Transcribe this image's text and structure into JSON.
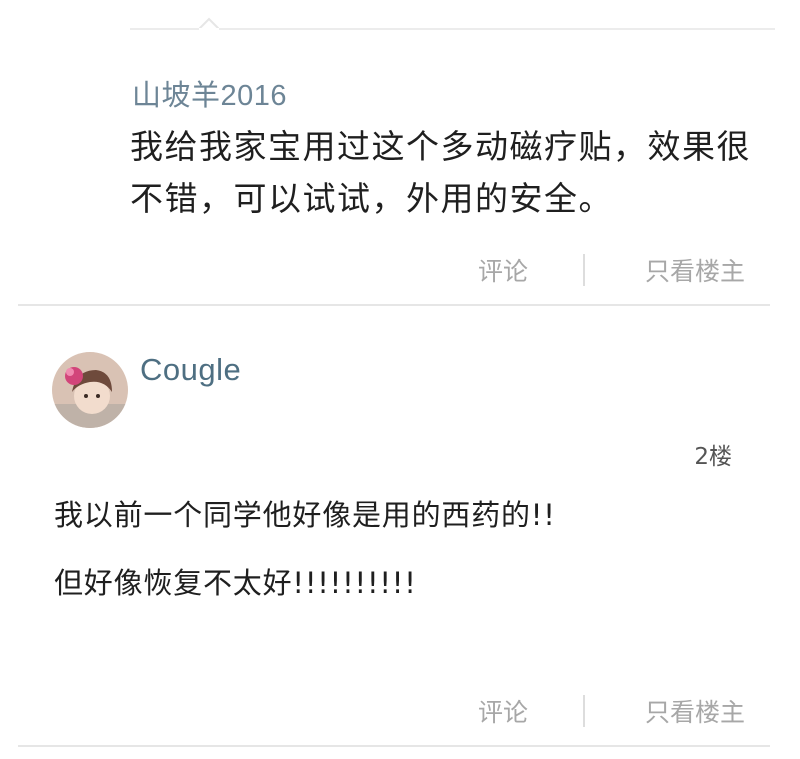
{
  "reply": {
    "author": "山坡羊2016",
    "text": "我给我家宝用过这个多动磁疗贴，效果很不错，可以试试，外用的安全。",
    "comment_label": "评论",
    "op_only_label": "只看楼主"
  },
  "post": {
    "username": "Cougle",
    "floor": "2楼",
    "lines": [
      "我以前一个同学他好像是用的西药的!!",
      "但好像恢复不太好!!!!!!!!!!"
    ],
    "comment_label": "评论",
    "op_only_label": "只看楼主"
  },
  "colors": {
    "username": "#4e6f82",
    "action_text": "#a7a7a7",
    "divider": "#e6e6e6"
  }
}
